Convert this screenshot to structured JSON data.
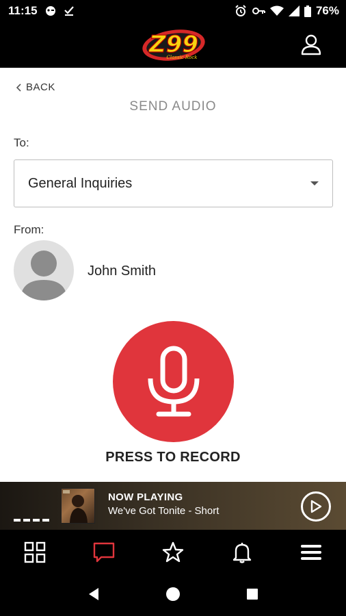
{
  "status_bar": {
    "time": "11:15",
    "battery": "76%"
  },
  "header": {
    "logo": {
      "text": "Z99",
      "subtitle": "Classic Rock"
    }
  },
  "nav": {
    "back_label": "BACK"
  },
  "page": {
    "title": "SEND AUDIO",
    "to_label": "To:",
    "to_value": "General Inquiries",
    "from_label": "From:",
    "sender_name": "John Smith",
    "record_label": "PRESS TO RECORD"
  },
  "now_playing": {
    "label": "NOW PLAYING",
    "track": "We've Got Tonite - Short"
  },
  "bottom_nav": {
    "items": [
      "grid-icon",
      "chat-icon",
      "star-icon",
      "bell-icon",
      "menu-icon"
    ],
    "active": "chat-icon"
  },
  "colors": {
    "accent": "#e0353c",
    "logo_yellow": "#f6d410",
    "logo_red": "#d62828"
  }
}
